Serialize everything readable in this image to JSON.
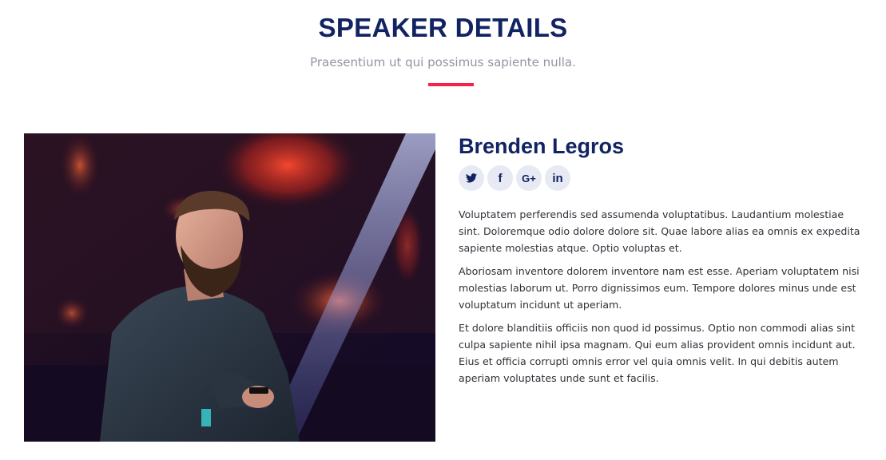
{
  "section": {
    "title": "SPEAKER DETAILS",
    "subtitle": "Praesentium ut qui possimus sapiente nulla.",
    "accent_color": "#f82249"
  },
  "speaker": {
    "name": "Brenden Legros",
    "photo_alt": "Speaker on stage",
    "social": [
      {
        "name": "twitter-icon",
        "glyph": "❧"
      },
      {
        "name": "facebook-icon",
        "glyph": "f"
      },
      {
        "name": "google-plus-icon",
        "glyph": "G+"
      },
      {
        "name": "linkedin-icon",
        "glyph": "in"
      }
    ],
    "bio": [
      "Voluptatem perferendis sed assumenda voluptatibus. Laudantium molestiae sint. Doloremque odio dolore dolore sit. Quae labore alias ea omnis ex expedita sapiente molestias atque. Optio voluptas et.",
      "Aboriosam inventore dolorem inventore nam est esse. Aperiam voluptatem nisi molestias laborum ut. Porro dignissimos eum. Tempore dolores minus unde est voluptatum incidunt ut aperiam.",
      "Et dolore blanditiis officiis non quod id possimus. Optio non commodi alias sint culpa sapiente nihil ipsa magnam. Qui eum alias provident omnis incidunt aut. Eius et officia corrupti omnis error vel quia omnis velit. In qui debitis autem aperiam voluptates unde sunt et facilis."
    ]
  },
  "colors": {
    "heading": "#112363",
    "subtitle": "#9195a2",
    "social_bg": "#e7e9f3"
  }
}
